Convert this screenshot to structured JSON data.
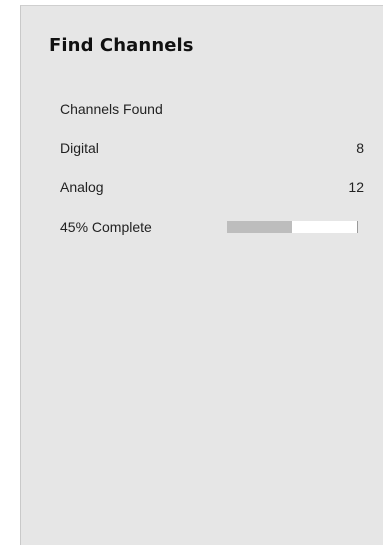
{
  "screen": {
    "title": "Find Channels"
  },
  "channels_found": {
    "label": "Channels Found"
  },
  "digital": {
    "label": "Digital",
    "count": "8"
  },
  "analog": {
    "label": "Analog",
    "count": "12"
  },
  "scan_progress": {
    "label": "45% Complete",
    "percent": 50
  },
  "colors": {
    "panel_background": "#e6e6e6",
    "progress_fill": "#bdbdbd",
    "progress_track": "#ffffff"
  }
}
